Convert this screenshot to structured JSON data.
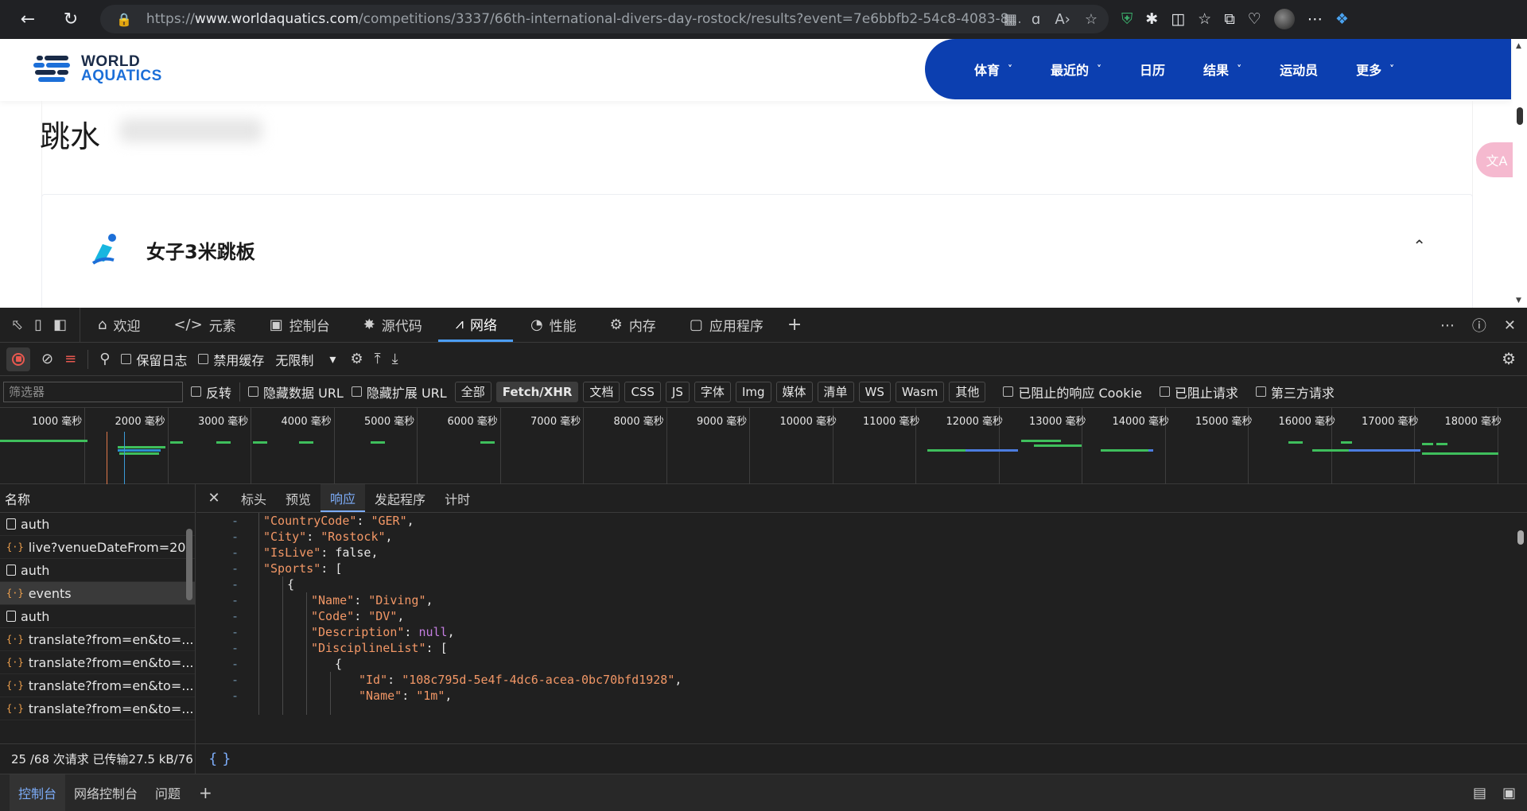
{
  "browser": {
    "url_prefix": "https://",
    "url_domain": "www.worldaquatics.com",
    "url_path": "/competitions/3337/66th-international-divers-day-rostock/results?event=7e6bbfb2-54c8-4083-8..."
  },
  "site": {
    "logo_line1": "WORLD",
    "logo_line2": "AQUATICS",
    "nav": [
      {
        "label": "体育",
        "has_dropdown": true
      },
      {
        "label": "最近的",
        "has_dropdown": true
      },
      {
        "label": "日历",
        "has_dropdown": false
      },
      {
        "label": "结果",
        "has_dropdown": true
      },
      {
        "label": "运动员",
        "has_dropdown": false
      },
      {
        "label": "更多",
        "has_dropdown": true
      }
    ],
    "page_title": "跳水",
    "event_title": "女子3米跳板",
    "translate_fab": "文A"
  },
  "devtools": {
    "tabs": [
      {
        "label": "欢迎",
        "icon": "home-icon"
      },
      {
        "label": "元素",
        "icon": "code-icon"
      },
      {
        "label": "控制台",
        "icon": "console-icon"
      },
      {
        "label": "源代码",
        "icon": "bug-icon"
      },
      {
        "label": "网络",
        "icon": "wifi-icon",
        "active": true
      },
      {
        "label": "性能",
        "icon": "gauge-icon"
      },
      {
        "label": "内存",
        "icon": "chip-icon"
      },
      {
        "label": "应用程序",
        "icon": "app-icon"
      }
    ],
    "toolbar": {
      "preserve_log": "保留日志",
      "disable_cache": "禁用缓存",
      "throttle": "无限制"
    },
    "filter": {
      "placeholder": "筛选器",
      "invert": "反转",
      "hide_data_url": "隐藏数据 URL",
      "hide_ext_url": "隐藏扩展 URL",
      "types": [
        "全部",
        "Fetch/XHR",
        "文档",
        "CSS",
        "JS",
        "字体",
        "Img",
        "媒体",
        "清单",
        "WS",
        "Wasm",
        "其他"
      ],
      "active_type": "Fetch/XHR",
      "blocked_cookies": "已阻止的响应 Cookie",
      "blocked_requests": "已阻止请求",
      "third_party": "第三方请求"
    },
    "timeline_ticks": [
      "1000 毫秒",
      "2000 毫秒",
      "3000 毫秒",
      "4000 毫秒",
      "5000 毫秒",
      "6000 毫秒",
      "7000 毫秒",
      "8000 毫秒",
      "9000 毫秒",
      "10000 毫秒",
      "11000 毫秒",
      "12000 毫秒",
      "13000 毫秒",
      "14000 毫秒",
      "15000 毫秒",
      "16000 毫秒",
      "17000 毫秒",
      "18000 毫秒"
    ],
    "names_header": "名称",
    "requests": [
      {
        "name": "auth",
        "type": "doc"
      },
      {
        "name": "live?venueDateFrom=20...",
        "type": "xhr"
      },
      {
        "name": "auth",
        "type": "doc"
      },
      {
        "name": "events",
        "type": "xhr",
        "selected": true
      },
      {
        "name": "auth",
        "type": "doc"
      },
      {
        "name": "translate?from=en&to=...",
        "type": "xhr"
      },
      {
        "name": "translate?from=en&to=...",
        "type": "xhr"
      },
      {
        "name": "translate?from=en&to=...",
        "type": "xhr"
      },
      {
        "name": "translate?from=en&to=...",
        "type": "xhr"
      }
    ],
    "detail_tabs": [
      "标头",
      "预览",
      "响应",
      "发起程序",
      "计时"
    ],
    "active_detail_tab": "响应",
    "response_lines": [
      {
        "indent": 1,
        "key": "\"CountryCode\"",
        "value": "\"GER\"",
        "vtype": "s",
        "trail": ","
      },
      {
        "indent": 1,
        "key": "\"City\"",
        "value": "\"Rostock\"",
        "vtype": "s",
        "trail": ","
      },
      {
        "indent": 1,
        "key": "\"IsLive\"",
        "value": "false",
        "vtype": "kw",
        "trail": ","
      },
      {
        "indent": 1,
        "key": "\"Sports\"",
        "value": "[",
        "vtype": "p",
        "trail": ""
      },
      {
        "indent": 2,
        "key": "",
        "value": "{",
        "vtype": "p",
        "trail": ""
      },
      {
        "indent": 3,
        "key": "\"Name\"",
        "value": "\"Diving\"",
        "vtype": "s",
        "trail": ","
      },
      {
        "indent": 3,
        "key": "\"Code\"",
        "value": "\"DV\"",
        "vtype": "s",
        "trail": ","
      },
      {
        "indent": 3,
        "key": "\"Description\"",
        "value": "null",
        "vtype": "nl",
        "trail": ","
      },
      {
        "indent": 3,
        "key": "\"DisciplineList\"",
        "value": "[",
        "vtype": "p",
        "trail": ""
      },
      {
        "indent": 4,
        "key": "",
        "value": "{",
        "vtype": "p",
        "trail": ""
      },
      {
        "indent": 5,
        "key": "\"Id\"",
        "value": "\"108c795d-5e4f-4dc6-acea-0bc70bfd1928\"",
        "vtype": "s",
        "trail": ","
      },
      {
        "indent": 5,
        "key": "\"Name\"",
        "value": "\"1m\"",
        "vtype": "s",
        "trail": ","
      }
    ],
    "status_text": "25 /68 次请求  已传输27.5 kB/76",
    "status_braces": "{ }",
    "drawer_tabs": [
      "控制台",
      "网络控制台",
      "问题"
    ],
    "active_drawer_tab": "控制台"
  }
}
